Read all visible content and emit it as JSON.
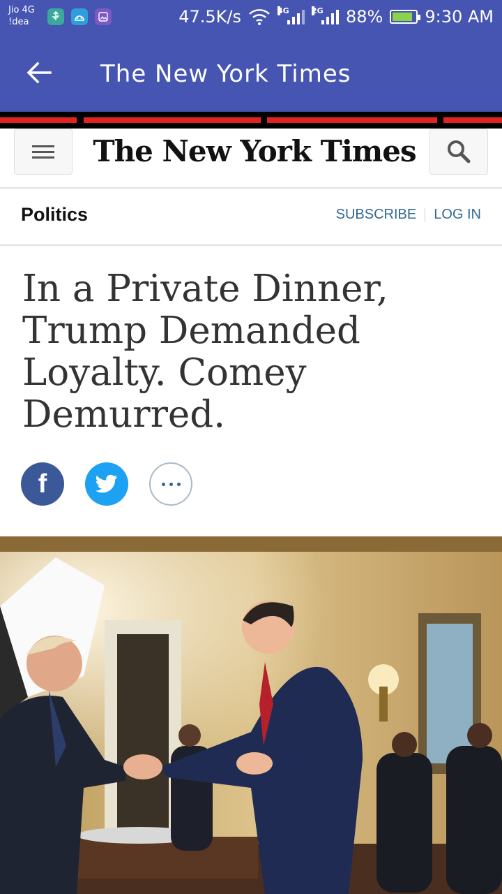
{
  "status_bar": {
    "carrier_1": "Jio 4G",
    "carrier_2": "!dea",
    "network_speed": "47.5K/s",
    "sim1_gen": "4G",
    "sim2_gen": "2G",
    "battery_percent": "88%",
    "battery_level": 0.88,
    "time": "9:30 AM",
    "notification_icons": [
      "usb-icon",
      "android-debug-icon",
      "gallery-icon"
    ]
  },
  "app_bar": {
    "title": "The New York Times",
    "back_icon": "arrow-left-icon"
  },
  "nyt_header": {
    "masthead": "The New York Times",
    "menu_icon": "hamburger-menu-icon",
    "search_icon": "search-icon"
  },
  "section": {
    "name": "Politics",
    "subscribe": "SUBSCRIBE",
    "login": "LOG IN"
  },
  "article": {
    "headline": "In a Private Dinner, Trump Demanded Loyalty. Comey Demurred."
  },
  "share": {
    "facebook_glyph": "f",
    "facebook_icon": "facebook-icon",
    "twitter_icon": "twitter-icon",
    "more_icon": "more-options-icon"
  },
  "colors": {
    "app_bar": "#4655b2",
    "stripe_red": "#e32222",
    "link_blue": "#326891",
    "facebook": "#3b5998",
    "twitter": "#1da1f2"
  }
}
